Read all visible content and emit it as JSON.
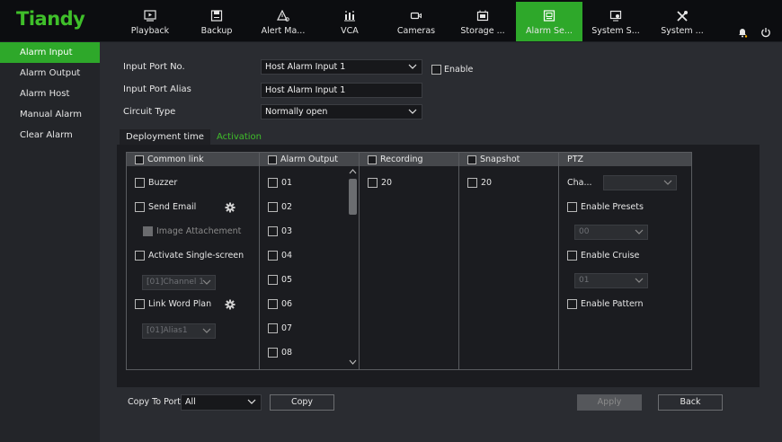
{
  "app": {
    "logo": "Tiandy"
  },
  "nav": [
    {
      "label": "Playback",
      "icon": "playback-icon"
    },
    {
      "label": "Backup",
      "icon": "backup-icon"
    },
    {
      "label": "Alert Ma...",
      "icon": "alert-icon"
    },
    {
      "label": "VCA",
      "icon": "vca-icon"
    },
    {
      "label": "Cameras",
      "icon": "camera-icon"
    },
    {
      "label": "Storage ...",
      "icon": "storage-icon"
    },
    {
      "label": "Alarm Se...",
      "icon": "alarm-settings-icon",
      "active": true
    },
    {
      "label": "System S...",
      "icon": "system-settings-icon"
    },
    {
      "label": "System ...",
      "icon": "tools-icon"
    }
  ],
  "sidebar": {
    "items": [
      {
        "label": "Alarm Input",
        "active": true
      },
      {
        "label": "Alarm Output"
      },
      {
        "label": "Alarm Host"
      },
      {
        "label": "Manual Alarm"
      },
      {
        "label": "Clear Alarm"
      }
    ]
  },
  "form": {
    "input_port_label": "Input Port No.",
    "input_port_value": "Host Alarm Input 1",
    "enable_label": "Enable",
    "alias_label": "Input Port Alias",
    "alias_value": "Host Alarm Input 1",
    "circuit_label": "Circuit Type",
    "circuit_value": "Normally open"
  },
  "tabs": [
    {
      "label": "Deployment time"
    },
    {
      "label": "Activation",
      "selected": true
    }
  ],
  "activation": {
    "common_link": {
      "header": "Common link",
      "buzzer": "Buzzer",
      "send_email": "Send Email",
      "image_attachment": "Image Attachement",
      "activate_single_screen": "Activate Single-screen",
      "channel_select": "[01]Channel 1",
      "link_word_plan": "Link Word Plan",
      "alias_select": "[01]Alias1"
    },
    "alarm_output": {
      "header": "Alarm Output",
      "items": [
        "01",
        "02",
        "03",
        "04",
        "05",
        "06",
        "07",
        "08"
      ]
    },
    "recording": {
      "header": "Recording",
      "items": [
        "20"
      ]
    },
    "snapshot": {
      "header": "Snapshot",
      "items": [
        "20"
      ]
    },
    "ptz": {
      "header": "PTZ",
      "channel_label": "Cha...",
      "enable_presets": "Enable Presets",
      "presets_value": "00",
      "enable_cruise": "Enable Cruise",
      "cruise_value": "01",
      "enable_pattern": "Enable Pattern"
    }
  },
  "bottom": {
    "copy_to_port_label": "Copy To Port",
    "copy_to_port_value": "All",
    "copy_button": "Copy",
    "apply_button": "Apply",
    "back_button": "Back"
  },
  "colors": {
    "accent": "#2ea82a",
    "logo": "#3fbf2a",
    "background": "#2a2c31"
  }
}
